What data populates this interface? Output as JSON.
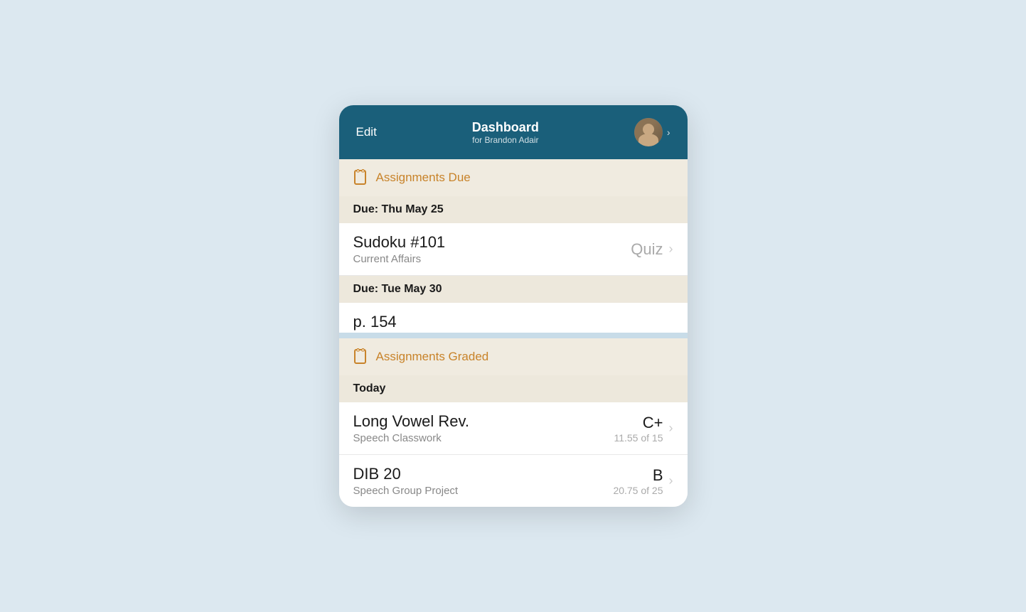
{
  "header": {
    "edit_label": "Edit",
    "title": "Dashboard",
    "subtitle": "for Brandon Adair",
    "chevron": "›"
  },
  "assignments_due": {
    "section_title": "Assignments Due",
    "icon_symbol": "🗒",
    "groups": [
      {
        "date": "Due: Thu May 25",
        "items": [
          {
            "name": "Sudoku #101",
            "subject": "Current Affairs",
            "type": "Quiz"
          }
        ]
      },
      {
        "date": "Due: Tue May 30",
        "items": [
          {
            "name": "p. 154",
            "subject": ""
          }
        ]
      }
    ]
  },
  "assignments_graded": {
    "section_title": "Assignments Graded",
    "icon_symbol": "🗒",
    "groups": [
      {
        "date": "Today",
        "items": [
          {
            "name": "Long Vowel Rev.",
            "subject": "Speech Classwork",
            "grade_letter": "C+",
            "grade_score": "11.55 of 15"
          },
          {
            "name": "DIB 20",
            "subject": "Speech Group Project",
            "grade_letter": "B",
            "grade_score": "20.75 of 25"
          }
        ]
      }
    ]
  }
}
